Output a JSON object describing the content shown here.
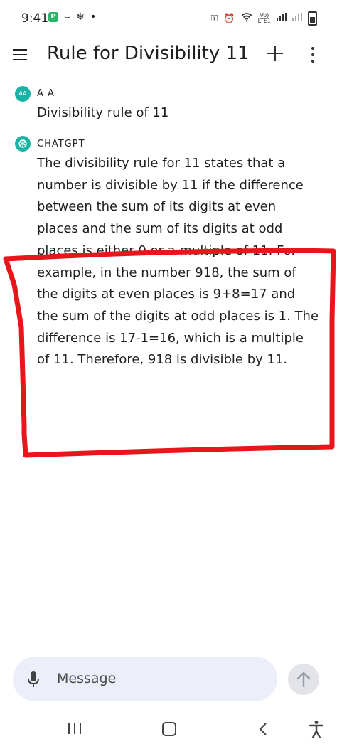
{
  "status_bar": {
    "time": "9:41",
    "volte_top": "Vo)",
    "volte_bottom": "LTE1"
  },
  "toolbar": {
    "title": "Rule for Divisibility 11"
  },
  "messages": [
    {
      "avatar": "AA",
      "sender": "A A",
      "text": "Divisibility rule of 11"
    },
    {
      "avatar_icon": "chatgpt-logo-icon",
      "sender": "CHATGPT",
      "text": "The divisibility rule for 11 states that a number is divisible by 11 if the difference between the sum of its digits at even places and the sum of its digits at odd places is either 0 or a multiple of 11. For example, in the number 918, the sum of the digits at even places is 9+8=17 and the sum of the digits at odd places is 1. The difference is 17-1=16, which is a multiple of 11. Therefore, 918 is divisible by 11."
    }
  ],
  "composer": {
    "placeholder": "Message"
  },
  "colors": {
    "avatar": "#19b3a6",
    "annotation": "#e8161b",
    "composer_bg": "#eceef9"
  }
}
